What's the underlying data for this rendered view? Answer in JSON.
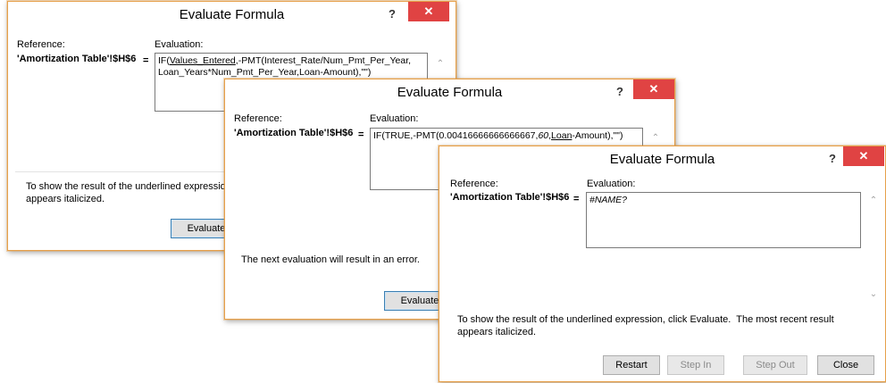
{
  "dialogs": [
    {
      "title": "Evaluate Formula",
      "help": "?",
      "close": "✕",
      "reference_label": "Reference:",
      "evaluation_label": "Evaluation:",
      "reference_value": "'Amortization Table'!$H$6",
      "equals": "=",
      "eval_pre": "IF(",
      "eval_underlined": "Values_Entered",
      "eval_post": ",-PMT(Interest_Rate/Num_Pmt_Per_Year,\nLoan_Years*Num_Pmt_Per_Year,Loan-Amount),\"\")",
      "note": "To show the result of the underlined expression, click Evaluate.  The most recent result\nappears italicized.",
      "evaluate_button": "Evaluate"
    },
    {
      "title": "Evaluate Formula",
      "help": "?",
      "close": "✕",
      "reference_label": "Reference:",
      "evaluation_label": "Evaluation:",
      "reference_value": "'Amortization Table'!$H$6",
      "equals": "=",
      "eval_pre": "IF(TRUE,-PMT(0.00416666666666667,",
      "eval_italic": "60",
      "eval_mid": ",",
      "eval_underlined": "Loan",
      "eval_post": "-Amount),\"\")",
      "note": "The next evaluation will result in an error.",
      "evaluate_button": "Evaluate"
    },
    {
      "title": "Evaluate Formula",
      "help": "?",
      "close": "✕",
      "reference_label": "Reference:",
      "evaluation_label": "Evaluation:",
      "reference_value": "'Amortization Table'!$H$6",
      "equals": "=",
      "eval_italic": "#NAME?",
      "note": "To show the result of the underlined expression, click Evaluate.  The most recent result\nappears italicized.",
      "buttons": {
        "restart": "Restart",
        "step_in": "Step In",
        "step_out": "Step Out",
        "close": "Close"
      }
    }
  ]
}
